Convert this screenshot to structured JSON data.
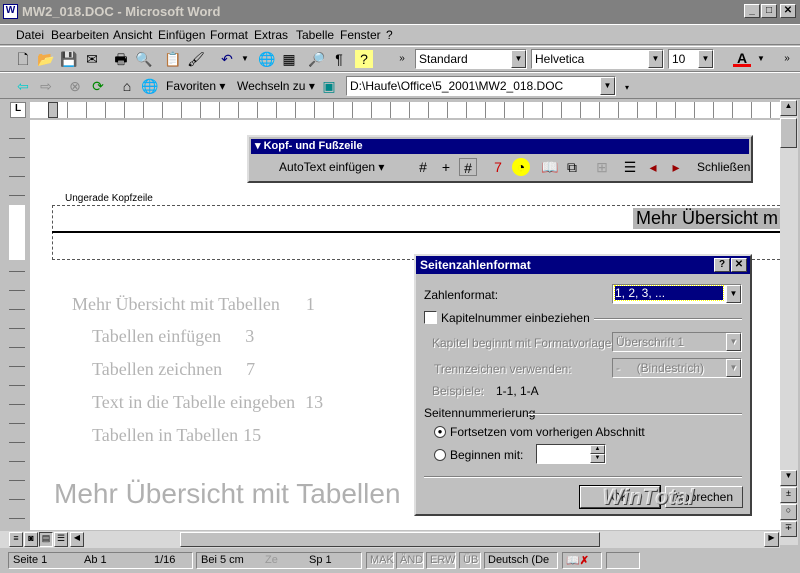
{
  "window": {
    "title": "MW2_018.DOC - Microsoft Word"
  },
  "menu": [
    "Datei",
    "Bearbeiten",
    "Ansicht",
    "Einfügen",
    "Format",
    "Extras",
    "Tabelle",
    "Fenster",
    "?"
  ],
  "formatting": {
    "style": "Standard",
    "font": "Helvetica",
    "size": "10"
  },
  "web": {
    "favorites": "Favoriten",
    "goto": "Wechseln zu",
    "address": "D:\\Haufe\\Office\\5_2001\\MW2_018.DOC"
  },
  "hf_toolbar": {
    "title": "Kopf- und Fußzeile",
    "autotext": "AutoText einfügen",
    "close": "Schließen"
  },
  "document": {
    "header_label": "Ungerade Kopfzeile",
    "header_text": "Mehr Übersicht m",
    "toc": [
      {
        "text": "Mehr Übersicht mit Tabellen",
        "page": "1"
      },
      {
        "text": "Tabellen einfügen",
        "page": "3"
      },
      {
        "text": "Tabellen zeichnen",
        "page": "7"
      },
      {
        "text": "Text in die Tabelle eingeben",
        "page": "13"
      },
      {
        "text": "Tabellen in Tabellen",
        "page": "15"
      }
    ],
    "heading": "Mehr Übersicht mit Tabellen"
  },
  "dialog": {
    "title": "Seitenzahlenformat",
    "number_format_label": "Zahlenformat:",
    "number_format_value": "1, 2, 3, ...",
    "include_chapter": "Kapitelnummer einbeziehen",
    "chapter_style_label": "Kapitel beginnt mit Formatvorlage:",
    "chapter_style_value": "Überschrift 1",
    "separator_label": "Trennzeichen verwenden:",
    "separator_value": "-     (Bindestrich)",
    "examples_label": "Beispiele:",
    "examples_value": "1-1, 1-A",
    "numbering_group": "Seitennummerierung",
    "continue": "Fortsetzen vom vorherigen Abschnitt",
    "start_at": "Beginnen mit:",
    "ok": "OK",
    "cancel": "Abbrechen",
    "watermark": "WinTotal"
  },
  "status": {
    "page": "Seite 1",
    "section": "Ab 1",
    "pages": "1/16",
    "at": "Bei 5 cm",
    "line": "Ze",
    "col": "Sp 1",
    "mak": "MAK",
    "and": "ÄND",
    "erw": "ERW",
    "ub": "ÜB",
    "lang": "Deutsch (De"
  }
}
